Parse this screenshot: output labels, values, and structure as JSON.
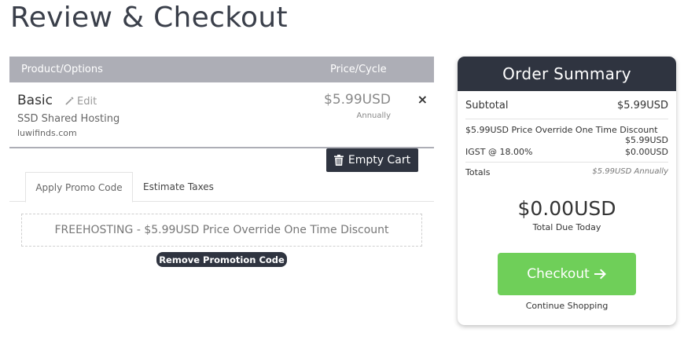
{
  "page": {
    "title": "Review & Checkout"
  },
  "cart": {
    "header": {
      "product": "Product/Options",
      "price": "Price/Cycle"
    },
    "item": {
      "name": "Basic",
      "edit_label": "Edit",
      "group": "SSD Shared Hosting",
      "domain": "luwifinds.com",
      "price": "$5.99USD",
      "cycle": "Annually",
      "remove_icon": "×"
    },
    "empty_cart_label": "Empty Cart"
  },
  "tabs": [
    {
      "label": "Apply Promo Code",
      "active": true
    },
    {
      "label": "Estimate Taxes",
      "active": false
    }
  ],
  "promo": {
    "applied_text": "FREEHOSTING - $5.99USD Price Override One Time Discount",
    "remove_label": "Remove Promotion Code"
  },
  "summary": {
    "title": "Order Summary",
    "subtotal_label": "Subtotal",
    "subtotal_value": "$5.99USD",
    "discount_label": "$5.99USD Price Override One Time Discount",
    "discount_value": "$5.99USD",
    "tax_label": "IGST @ 18.00%",
    "tax_value": "$0.00USD",
    "totals_label": "Totals",
    "totals_value": "$5.99USD Annually",
    "total_due": "$0.00USD",
    "total_due_label": "Total Due Today",
    "checkout_label": "Checkout",
    "continue_label": "Continue Shopping"
  },
  "colors": {
    "header_gray": "#adaeb6",
    "dark": "#2f3440",
    "checkout_green": "#6fcf59"
  }
}
